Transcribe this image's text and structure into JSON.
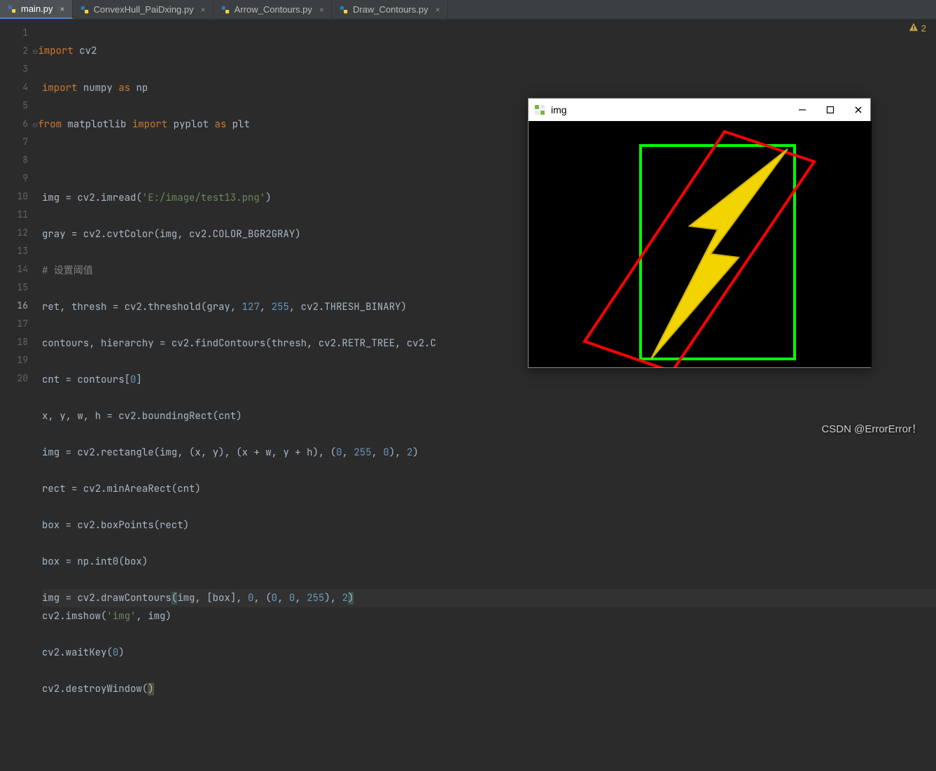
{
  "tabs": [
    {
      "label": "main.py",
      "active": true
    },
    {
      "label": "ConvexHull_PaiDxing.py",
      "active": false
    },
    {
      "label": "Arrow_Contours.py",
      "active": false
    },
    {
      "label": "Draw_Contours.py",
      "active": false
    }
  ],
  "warning_count": "2",
  "line_numbers": [
    "1",
    "2",
    "3",
    "4",
    "5",
    "6",
    "7",
    "8",
    "9",
    "10",
    "11",
    "12",
    "13",
    "14",
    "15",
    "16",
    "17",
    "18",
    "19",
    "20"
  ],
  "active_line": "16",
  "code": {
    "l1": {
      "kw_import": "import",
      "mod": "cv2"
    },
    "l2": {
      "kw_import": "import",
      "mod": "numpy",
      "kw_as": "as",
      "alias": "np"
    },
    "l3": {
      "kw_from": "from",
      "pkg": "matplotlib",
      "kw_import": "import",
      "mod": "pyplot",
      "kw_as": "as",
      "alias": "plt"
    },
    "l5": {
      "lhs": "img = cv2.imread(",
      "arg_str": "'E:/image/test13.png'",
      "rhs": ")"
    },
    "l6": {
      "lhs": "gray = cv2.cvtColor(img",
      "comma": ", ",
      "const": "cv2.COLOR_BGR2GRAY",
      "rhs": ")"
    },
    "l7": {
      "comment": "# 设置阈值"
    },
    "l8": {
      "a": "ret",
      "b": "thresh = cv2.threshold(gray",
      "n1": "127",
      "n2": "255",
      "tail": "cv2.THRESH_BINARY)"
    },
    "l9": {
      "a": "contours",
      "b": "hierarchy = cv2.findContours(thresh",
      "c": "cv2.RETR_TREE",
      "d": "cv2.C"
    },
    "l10": {
      "text": "cnt = contours[",
      "idx": "0",
      "close": "]"
    },
    "l11": {
      "vars": "x, y, w, h = cv2.boundingRect(cnt)"
    },
    "l12": {
      "a": "img = cv2.rectangle(img",
      "b": "(x",
      "c": "y)",
      "d": "(x + w",
      "e": "y + h)",
      "f": "(",
      "n0": "0",
      "n255": "255",
      "n0b": "0",
      "g": ")",
      "n2": "2",
      "h": ")"
    },
    "l13": {
      "text": "rect = cv2.minAreaRect(cnt)"
    },
    "l14": {
      "text": "box = cv2.boxPoints(rect)"
    },
    "l15": {
      "text": "box = np.int0(box)"
    },
    "l16": {
      "a": "img = cv2.drawContours",
      "open": "(",
      "b": "img",
      "c": "[box]",
      "n0": "0",
      "d": "(",
      "n0b": "0",
      "n0c": "0",
      "n255": "255",
      "e": ")",
      "n2": "2",
      "close": ")"
    },
    "l17": {
      "a": "cv2.imshow(",
      "s": "'img'",
      "b": ", img)"
    },
    "l18": {
      "a": "cv2.waitKey(",
      "n": "0",
      "b": ")"
    },
    "l19": {
      "a": "cv2.destroyWindow(",
      "b": ")"
    }
  },
  "cv_window": {
    "title": "img"
  },
  "watermark": "CSDN @ErrorError！"
}
